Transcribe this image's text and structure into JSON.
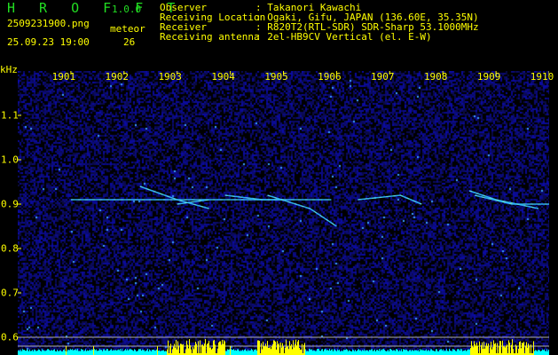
{
  "header": {
    "app_name": "H R O F F T",
    "version": "1.0.0",
    "filename": "2509231900.png",
    "datetime": "25.09.23 19:00",
    "meteor_label": "meteor",
    "meteor_count": "26",
    "fields": [
      {
        "label": "Observer",
        "value": ": Takanori Kawachi"
      },
      {
        "label": "Receiving Location",
        "value": ": Ogaki, Gifu, JAPAN (136.60E, 35.35N)"
      },
      {
        "label": "Receiver",
        "value": ": R820T2(RTL-SDR) SDR-Sharp 53.1000MHz"
      },
      {
        "label": "Receiving antenna",
        "value": ": 2el-HB9CV Vertical (el. E-W)"
      }
    ]
  },
  "colors": {
    "text": "#ffff00",
    "logo": "#22dd22",
    "noise": "#1a1a9a",
    "level_base": "#00ffff",
    "level_peak": "#ffff00",
    "guide_lines": "#b0b0b0"
  },
  "chart_data": {
    "type": "heatmap",
    "ylabel": "kHz",
    "xlim": [
      1900,
      1910
    ],
    "ylim": [
      0.54,
      1.2
    ],
    "x_ticks": [
      "1901",
      "1902",
      "1903",
      "1904",
      "1905",
      "1906",
      "1907",
      "1908",
      "1909",
      "1910"
    ],
    "y_ticks": [
      "1.1",
      "1.0",
      "0.9",
      "0.8",
      "0.7",
      "0.6"
    ],
    "guide_lines_khz": [
      0.62,
      0.6,
      0.58
    ],
    "meteor_traces": [
      {
        "x": [
          1901.0,
          1902.5,
          1905.9
        ],
        "y": [
          0.91,
          0.91,
          0.91
        ]
      },
      {
        "x": [
          1902.3,
          1903.0,
          1903.6
        ],
        "y": [
          0.94,
          0.91,
          0.89
        ]
      },
      {
        "x": [
          1903.0,
          1903.6
        ],
        "y": [
          0.9,
          0.91
        ]
      },
      {
        "x": [
          1903.9,
          1904.6,
          1905.0
        ],
        "y": [
          0.92,
          0.91,
          0.91
        ]
      },
      {
        "x": [
          1904.7,
          1905.5,
          1906.0
        ],
        "y": [
          0.92,
          0.89,
          0.85
        ]
      },
      {
        "x": [
          1906.4,
          1907.2,
          1907.6
        ],
        "y": [
          0.91,
          0.92,
          0.9
        ]
      },
      {
        "x": [
          1908.5,
          1909.0,
          1909.8
        ],
        "y": [
          0.93,
          0.91,
          0.89
        ]
      },
      {
        "x": [
          1908.6,
          1909.3,
          1910.0
        ],
        "y": [
          0.92,
          0.9,
          0.9
        ]
      }
    ],
    "level_peaks": [
      {
        "x": [
          1902.8,
          1903.9
        ]
      },
      {
        "x": [
          1904.5,
          1905.4
        ]
      },
      {
        "x": [
          1908.5,
          1909.7
        ]
      }
    ]
  }
}
